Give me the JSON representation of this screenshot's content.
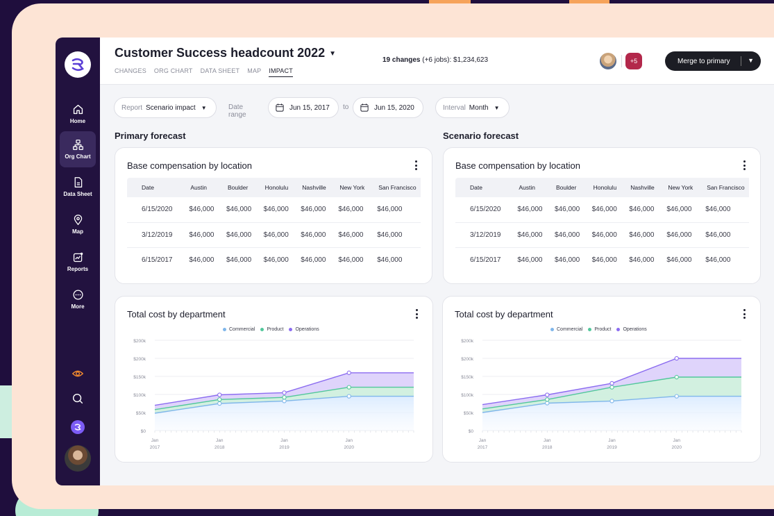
{
  "app": {
    "title": "Customer Success headcount 2022",
    "tabs": [
      "CHANGES",
      "ORG CHART",
      "DATA SHEET",
      "MAP",
      "IMPACT"
    ],
    "active_tab": "IMPACT",
    "changes_bold": "19 changes",
    "changes_rest": " (+6 jobs): $1,234,623",
    "collaborators_extra": "+5",
    "merge_label": "Merge to primary"
  },
  "sidebar": {
    "items": [
      {
        "label": "Home",
        "icon": "home-icon"
      },
      {
        "label": "Org Chart",
        "icon": "org-chart-icon"
      },
      {
        "label": "Data Sheet",
        "icon": "data-sheet-icon"
      },
      {
        "label": "Map",
        "icon": "map-pin-icon"
      },
      {
        "label": "Reports",
        "icon": "reports-icon"
      },
      {
        "label": "More",
        "icon": "more-icon"
      }
    ],
    "active": "Org Chart"
  },
  "filters": {
    "report_label": "Report",
    "report_value": "Scenario impact",
    "date_range_label": "Date range",
    "date_from": "Jun 15, 2017",
    "to_label": "to",
    "date_to": "Jun 15, 2020",
    "interval_label": "Interval",
    "interval_value": "Month"
  },
  "colors": {
    "commercial": "#7fb6ea",
    "product": "#52c79b",
    "operations": "#8b6cf0",
    "badge": "#b3284b",
    "sidebar": "#22123f"
  },
  "panels": [
    {
      "section_title": "Primary forecast",
      "table_title": "Base compensation by location",
      "columns": [
        "Date",
        "Austin",
        "Boulder",
        "Honolulu",
        "Nashville",
        "New York",
        "San Francisco"
      ],
      "rows": [
        [
          "6/15/2020",
          "$46,000",
          "$46,000",
          "$46,000",
          "$46,000",
          "$46,000",
          "$46,000"
        ],
        [
          "3/12/2019",
          "$46,000",
          "$46,000",
          "$46,000",
          "$46,000",
          "$46,000",
          "$46,000"
        ],
        [
          "6/15/2017",
          "$46,000",
          "$46,000",
          "$46,000",
          "$46,000",
          "$46,000",
          "$46,000"
        ]
      ],
      "chart_title": "Total cost by department"
    },
    {
      "section_title": "Scenario forecast",
      "table_title": "Base compensation by location",
      "columns": [
        "Date",
        "Austin",
        "Boulder",
        "Honolulu",
        "Nashville",
        "New York",
        "San Francisco"
      ],
      "rows": [
        [
          "6/15/2020",
          "$46,000",
          "$46,000",
          "$46,000",
          "$46,000",
          "$46,000",
          "$46,000"
        ],
        [
          "3/12/2019",
          "$46,000",
          "$46,000",
          "$46,000",
          "$46,000",
          "$46,000",
          "$46,000"
        ],
        [
          "6/15/2017",
          "$46,000",
          "$46,000",
          "$46,000",
          "$46,000",
          "$46,000",
          "$46,000"
        ]
      ],
      "chart_title": "Total cost by department"
    }
  ],
  "chart_data": [
    {
      "type": "area",
      "title": "Total cost by department",
      "legend": [
        "Commercial",
        "Product",
        "Operations"
      ],
      "y_ticks": [
        "$200k",
        "$200k",
        "$150k",
        "$100k",
        "$50k",
        "$0"
      ],
      "x_ticks": [
        [
          "Jan",
          "2017"
        ],
        [
          "Jan",
          "2018"
        ],
        [
          "Jan",
          "2019"
        ],
        [
          "Jan",
          "2020"
        ]
      ],
      "x": [
        2017,
        2018,
        2019,
        2020,
        2021
      ],
      "ylim": [
        0,
        250000
      ],
      "series": [
        {
          "name": "Commercial",
          "values": [
            48000,
            75000,
            82000,
            95000,
            95000
          ]
        },
        {
          "name": "Product",
          "values": [
            58000,
            86000,
            92000,
            120000,
            120000
          ]
        },
        {
          "name": "Operations",
          "values": [
            70000,
            99000,
            105000,
            160000,
            160000
          ]
        }
      ]
    },
    {
      "type": "area",
      "title": "Total cost by department",
      "legend": [
        "Commercial",
        "Product",
        "Operations"
      ],
      "y_ticks": [
        "$200k",
        "$200k",
        "$150k",
        "$100k",
        "$50k",
        "$0"
      ],
      "x_ticks": [
        [
          "Jan",
          "2017"
        ],
        [
          "Jan",
          "2018"
        ],
        [
          "Jan",
          "2019"
        ],
        [
          "Jan",
          "2020"
        ]
      ],
      "x": [
        2017,
        2018,
        2019,
        2020,
        2021
      ],
      "ylim": [
        0,
        250000
      ],
      "series": [
        {
          "name": "Commercial",
          "values": [
            50000,
            76000,
            82000,
            95000,
            95000
          ]
        },
        {
          "name": "Product",
          "values": [
            60000,
            86000,
            120000,
            148000,
            148000
          ]
        },
        {
          "name": "Operations",
          "values": [
            72000,
            99000,
            131000,
            200000,
            200000
          ]
        }
      ]
    }
  ]
}
